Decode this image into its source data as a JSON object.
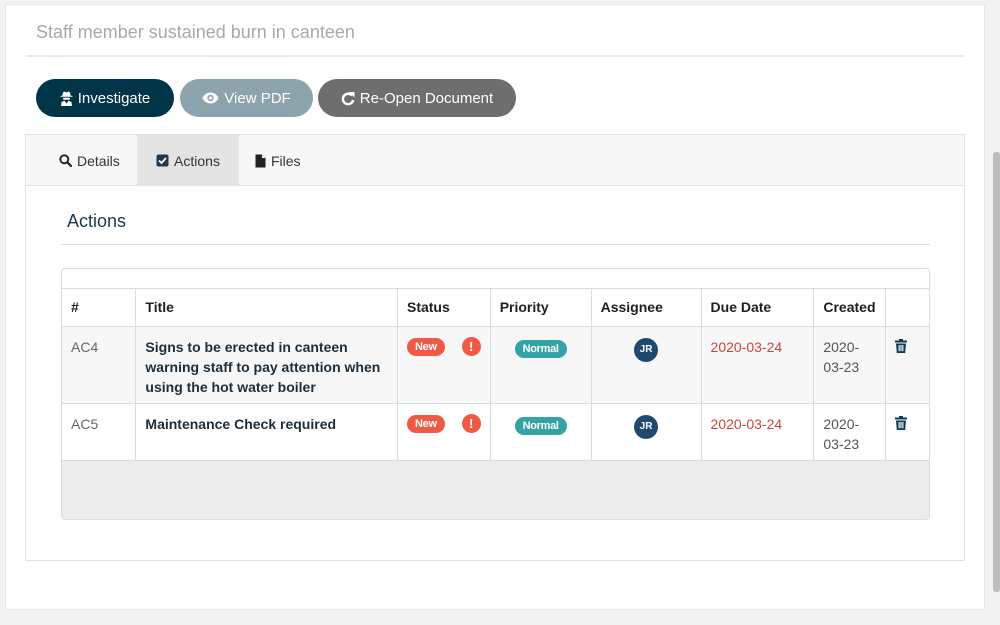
{
  "document": {
    "title": "Staff member sustained burn in canteen"
  },
  "toolbar": {
    "investigate_label": "Investigate",
    "view_pdf_label": "View PDF",
    "reopen_label": "Re-Open Document"
  },
  "tabs": [
    {
      "label": "Details",
      "icon": "search-icon"
    },
    {
      "label": "Actions",
      "icon": "checkbox-icon",
      "active": true
    },
    {
      "label": "Files",
      "icon": "file-icon"
    }
  ],
  "actions": {
    "heading": "Actions",
    "columns": [
      "#",
      "Title",
      "Status",
      "Priority",
      "Assignee",
      "Due Date",
      "Created"
    ],
    "rows": [
      {
        "id": "AC4",
        "title": "Signs to be erected in canteen warning staff to pay attention when using the hot water boiler",
        "status": "New",
        "priority": "Normal",
        "assignee": "JR",
        "due_date": "2020-03-24",
        "created": "2020-03-23"
      },
      {
        "id": "AC5",
        "title": "Maintenance Check required",
        "status": "New",
        "priority": "Normal",
        "assignee": "JR",
        "due_date": "2020-03-24",
        "created": "2020-03-23"
      }
    ]
  },
  "colors": {
    "primary": "#003547",
    "status_new": "#f05a45",
    "priority_normal": "#35a3a5",
    "due_date": "#c9463d",
    "assignee_avatar": "#1f4a6e"
  }
}
